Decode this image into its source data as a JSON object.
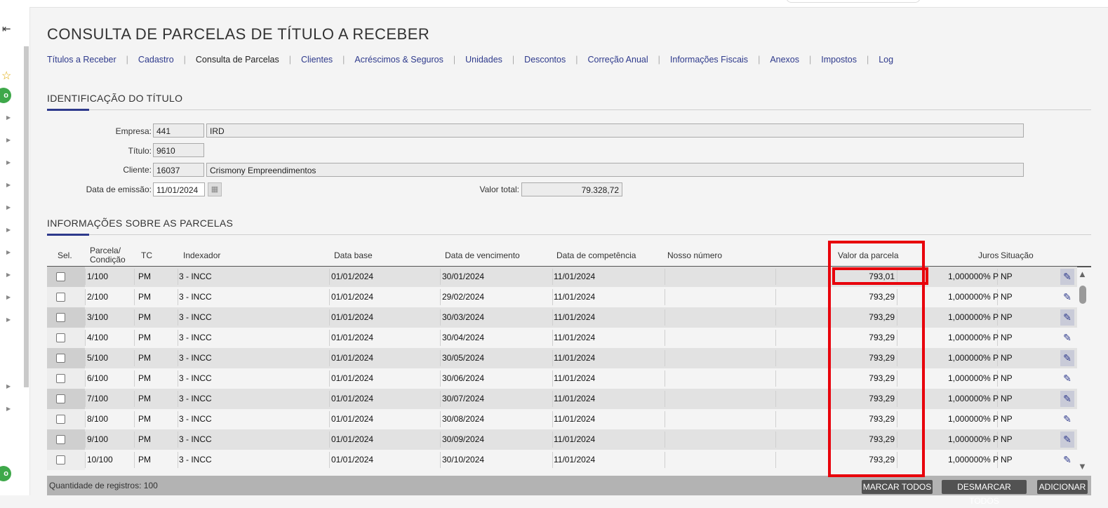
{
  "page": {
    "title": "CONSULTA DE PARCELAS DE TÍTULO A RECEBER",
    "tabs": [
      {
        "label": "Títulos a Receber"
      },
      {
        "label": "Cadastro"
      },
      {
        "label": "Consulta de Parcelas"
      },
      {
        "label": "Clientes"
      },
      {
        "label": "Acréscimos & Seguros"
      },
      {
        "label": "Unidades"
      },
      {
        "label": "Descontos"
      },
      {
        "label": "Correção Anual"
      },
      {
        "label": "Informações Fiscais"
      },
      {
        "label": "Anexos"
      },
      {
        "label": "Impostos"
      },
      {
        "label": "Log"
      }
    ],
    "active_tab": "Consulta de Parcelas"
  },
  "rail": {
    "green_badge_1": "o",
    "green_badge_2": "o"
  },
  "identificacao": {
    "heading": "IDENTIFICAÇÃO DO TÍTULO",
    "empresa_label": "Empresa:",
    "empresa_code": "441",
    "empresa_name": "IRD",
    "titulo_label": "Título:",
    "titulo_value": "9610",
    "cliente_label": "Cliente:",
    "cliente_code": "16037",
    "cliente_name": "Crismony Empreendimentos",
    "emissao_label": "Data de emissão:",
    "emissao_value": "11/01/2024",
    "valor_total_label": "Valor total:",
    "valor_total_value": "79.328,72"
  },
  "parcelas": {
    "heading": "INFORMAÇÕES SOBRE AS PARCELAS",
    "headers": {
      "sel": "Sel.",
      "parcela_1": "Parcela/",
      "parcela_2": "Condição",
      "tc": "TC",
      "indexador": "Indexador",
      "data_base": "Data base",
      "data_vencimento": "Data de vencimento",
      "data_competencia": "Data de competência",
      "nosso_numero": "Nosso número",
      "valor_parcela": "Valor da parcela",
      "juros": "Juros",
      "situacao": "Situação"
    },
    "rows": [
      {
        "parcela": "1/100",
        "tc": "PM",
        "indexador": "3 - INCC",
        "data_base": "01/01/2024",
        "vencimento": "30/01/2024",
        "competencia": "11/01/2024",
        "nosso_numero": "",
        "valor": "793,01",
        "juros": "1,000000% P",
        "situacao": "NP"
      },
      {
        "parcela": "2/100",
        "tc": "PM",
        "indexador": "3 - INCC",
        "data_base": "01/01/2024",
        "vencimento": "29/02/2024",
        "competencia": "11/01/2024",
        "nosso_numero": "",
        "valor": "793,29",
        "juros": "1,000000% P",
        "situacao": "NP"
      },
      {
        "parcela": "3/100",
        "tc": "PM",
        "indexador": "3 - INCC",
        "data_base": "01/01/2024",
        "vencimento": "30/03/2024",
        "competencia": "11/01/2024",
        "nosso_numero": "",
        "valor": "793,29",
        "juros": "1,000000% P",
        "situacao": "NP"
      },
      {
        "parcela": "4/100",
        "tc": "PM",
        "indexador": "3 - INCC",
        "data_base": "01/01/2024",
        "vencimento": "30/04/2024",
        "competencia": "11/01/2024",
        "nosso_numero": "",
        "valor": "793,29",
        "juros": "1,000000% P",
        "situacao": "NP"
      },
      {
        "parcela": "5/100",
        "tc": "PM",
        "indexador": "3 - INCC",
        "data_base": "01/01/2024",
        "vencimento": "30/05/2024",
        "competencia": "11/01/2024",
        "nosso_numero": "",
        "valor": "793,29",
        "juros": "1,000000% P",
        "situacao": "NP"
      },
      {
        "parcela": "6/100",
        "tc": "PM",
        "indexador": "3 - INCC",
        "data_base": "01/01/2024",
        "vencimento": "30/06/2024",
        "competencia": "11/01/2024",
        "nosso_numero": "",
        "valor": "793,29",
        "juros": "1,000000% P",
        "situacao": "NP"
      },
      {
        "parcela": "7/100",
        "tc": "PM",
        "indexador": "3 - INCC",
        "data_base": "01/01/2024",
        "vencimento": "30/07/2024",
        "competencia": "11/01/2024",
        "nosso_numero": "",
        "valor": "793,29",
        "juros": "1,000000% P",
        "situacao": "NP"
      },
      {
        "parcela": "8/100",
        "tc": "PM",
        "indexador": "3 - INCC",
        "data_base": "01/01/2024",
        "vencimento": "30/08/2024",
        "competencia": "11/01/2024",
        "nosso_numero": "",
        "valor": "793,29",
        "juros": "1,000000% P",
        "situacao": "NP"
      },
      {
        "parcela": "9/100",
        "tc": "PM",
        "indexador": "3 - INCC",
        "data_base": "01/01/2024",
        "vencimento": "30/09/2024",
        "competencia": "11/01/2024",
        "nosso_numero": "",
        "valor": "793,29",
        "juros": "1,000000% P",
        "situacao": "NP"
      },
      {
        "parcela": "10/100",
        "tc": "PM",
        "indexador": "3 - INCC",
        "data_base": "01/01/2024",
        "vencimento": "30/10/2024",
        "competencia": "11/01/2024",
        "nosso_numero": "",
        "valor": "793,29",
        "juros": "1,000000% P",
        "situacao": "NP"
      }
    ],
    "footer": {
      "count_label": "Quantidade de registros:",
      "count_value": "100",
      "btn_marcar": "MARCAR TODOS",
      "btn_desmarcar": "DESMARCAR TODOS",
      "btn_adicionar": "ADICIONAR"
    }
  },
  "colors": {
    "accent": "#2e3a8c",
    "highlight": "#e8000b",
    "badge_green": "#3ea84a"
  }
}
